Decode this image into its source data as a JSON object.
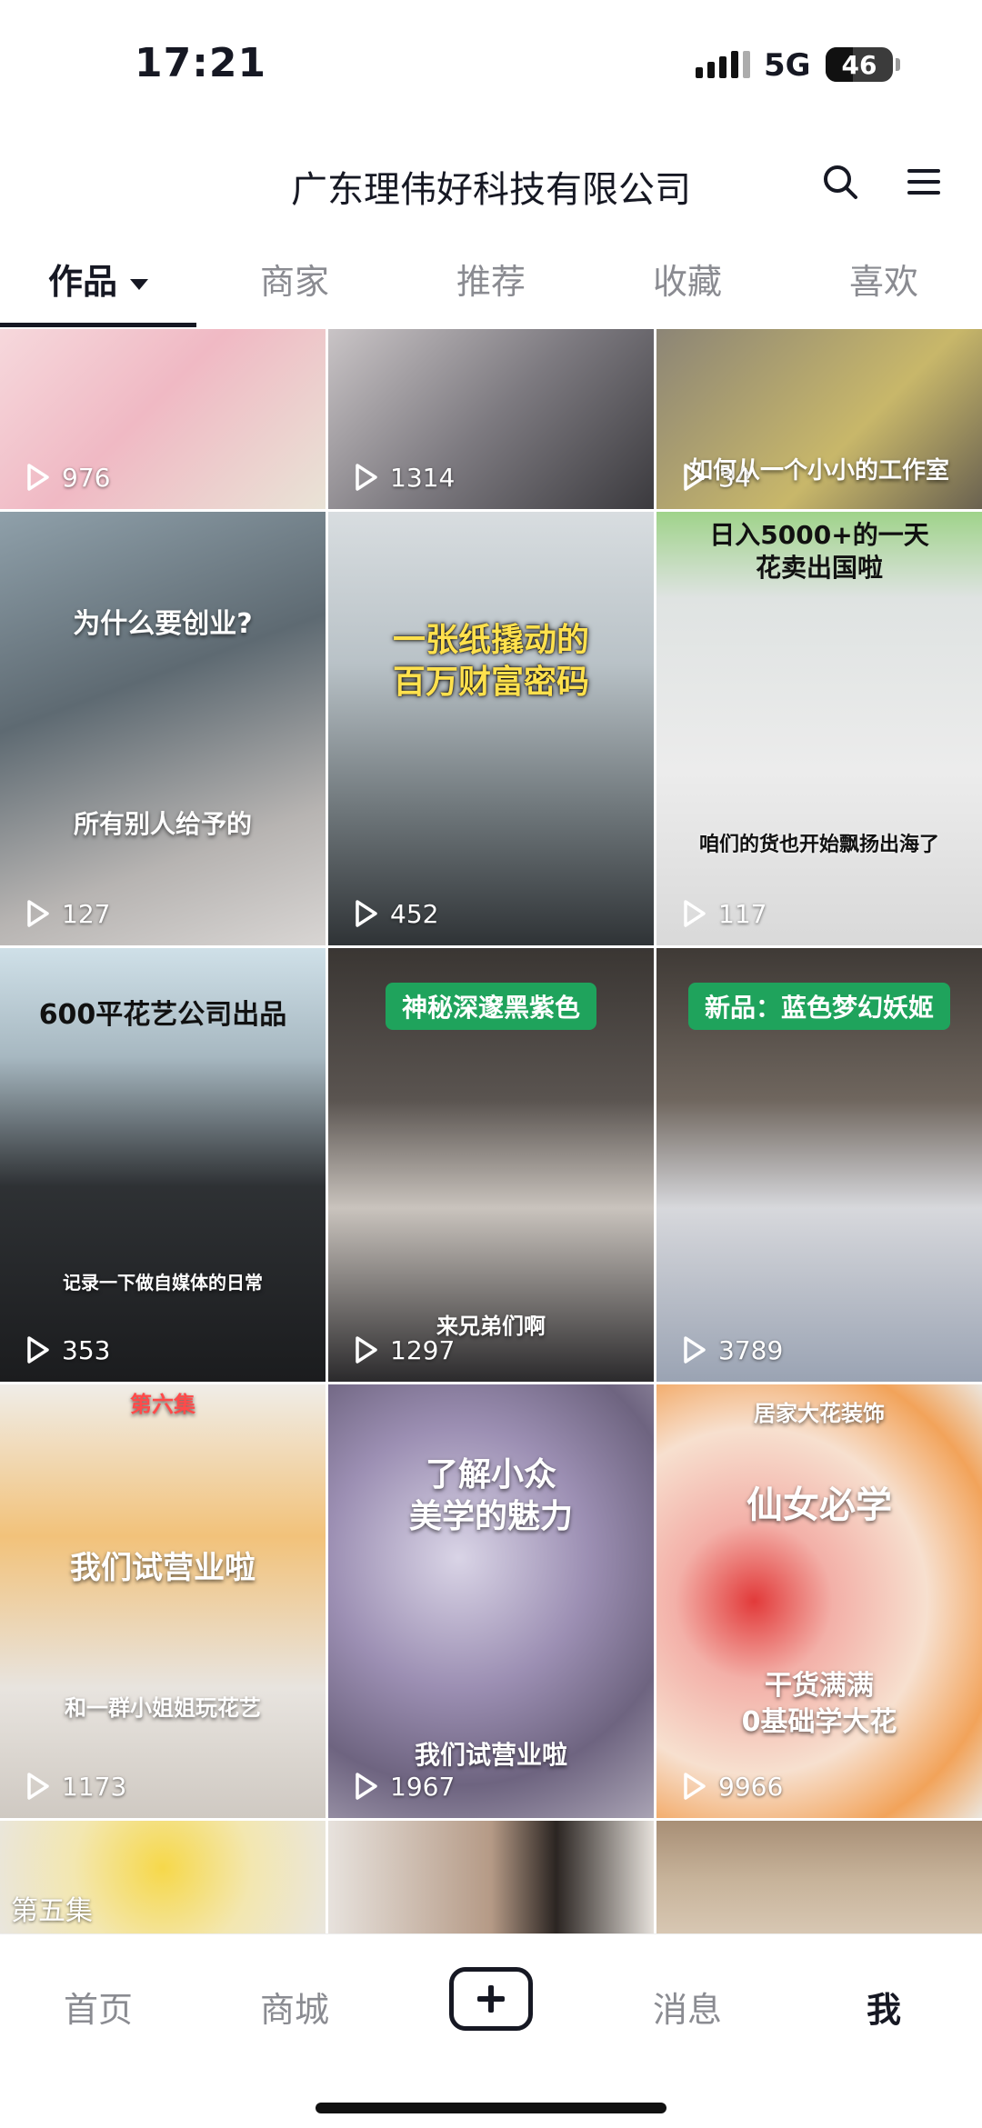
{
  "status_bar": {
    "time": "17:21",
    "network": "5G",
    "battery": "46"
  },
  "header": {
    "title": "广东理伟好科技有限公司",
    "search_icon": "search-icon",
    "menu_icon": "menu-icon"
  },
  "tabs": [
    {
      "label": "作品",
      "active": true
    },
    {
      "label": "商家",
      "active": false
    },
    {
      "label": "推荐",
      "active": false
    },
    {
      "label": "收藏",
      "active": false
    },
    {
      "label": "喜欢",
      "active": false
    }
  ],
  "videos": [
    {
      "plays": "976",
      "overlay": ""
    },
    {
      "plays": "1314",
      "overlay": ""
    },
    {
      "plays": "34",
      "overlay": "如何从一个小小的工作室"
    },
    {
      "plays": "127",
      "overlay": "为什么要创业?",
      "caption": "所有别人给予的"
    },
    {
      "plays": "452",
      "overlay": "一张纸撬动的",
      "overlay2": "百万财富密码"
    },
    {
      "plays": "117",
      "overlay": "日入5000+的一天",
      "overlay2": "花卖出国啦",
      "caption": "咱们的货也开始飘扬出海了"
    },
    {
      "plays": "353",
      "overlay": "600平花艺公司出品",
      "caption": "记录一下做自媒体的日常"
    },
    {
      "plays": "1297",
      "label": "神秘深邃黑紫色",
      "caption": "来兄弟们啊"
    },
    {
      "plays": "3789",
      "label": "新品：蓝色梦幻妖姬"
    },
    {
      "plays": "1173",
      "overlay": "我们试营业啦",
      "top": "第六集",
      "caption": "和一群小姐姐玩花艺"
    },
    {
      "plays": "1967",
      "overlay": "了解小众",
      "overlay2": "美学的魅力",
      "caption": "我们试营业啦"
    },
    {
      "plays": "9966",
      "overlay": "仙女必学",
      "top": "居家大花装饰",
      "caption": "干货满满",
      "caption2": "0基础学大花"
    },
    {
      "plays": "",
      "top": "第五集"
    },
    {
      "plays": ""
    },
    {
      "plays": ""
    }
  ],
  "bottom_nav": {
    "home": "首页",
    "mall": "商城",
    "messages": "消息",
    "me": "我"
  }
}
